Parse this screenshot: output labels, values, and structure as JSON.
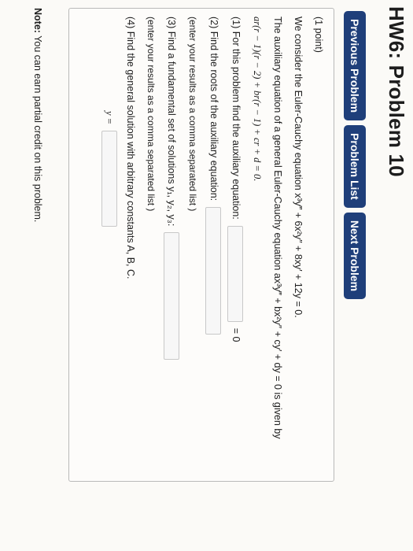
{
  "page": {
    "title": "HW6: Problem 10"
  },
  "nav": {
    "prev": "Previous Problem",
    "list": "Problem List",
    "next": "Next Problem"
  },
  "problem": {
    "points": "(1 point)",
    "intro": "We consider the Euler-Cauchy equation x³y‴ + 6x²y″ + 8xy′ + 12y = 0.",
    "aux_1": "The auxiliary equation of a general Euler-Cauchy equation ax³y‴ + bx²y″ + cy′ + dy = 0 is given by",
    "aux_2": "ar(r − 1)(r − 2) + br(r − 1) + cr + d = 0.",
    "q1": "(1) For this problem find the auxiliary equation:",
    "q1_suffix": "= 0",
    "q2": "(2) Find the roots of the auxiliary equation:",
    "q2_suffix": "(enter your results as a comma separated list )",
    "q3": "(3) Find a fundamental set of solutions y₁, y₂, y₃:",
    "q3_suffix": "(enter your results as a comma separated list )",
    "q4": "(4) Find the general solution with arbitrary constants A, B, C.",
    "q4_y": "y ="
  },
  "footer": {
    "note_label": "Note:",
    "note_text": "You can earn partial credit on this problem."
  }
}
